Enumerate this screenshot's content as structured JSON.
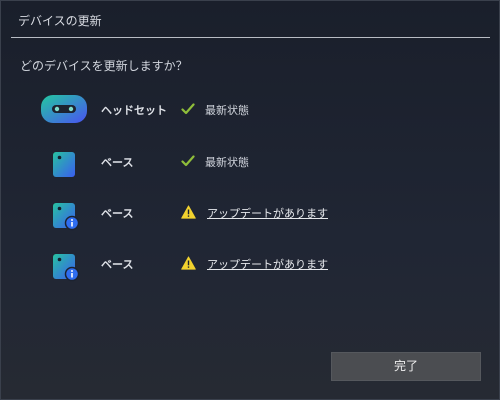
{
  "dialog": {
    "title": "デバイスの更新",
    "question": "どのデバイスを更新しますか？",
    "done_label": "完了"
  },
  "devices": [
    {
      "name": "ヘッドセット",
      "icon": "headset-icon",
      "status": "up-to-date",
      "status_label": "最新状態"
    },
    {
      "name": "ベース",
      "icon": "base-station-icon",
      "status": "up-to-date",
      "status_label": "最新状態"
    },
    {
      "name": "ベース",
      "icon": "base-station-info-icon",
      "status": "update-available",
      "status_label": "アップデートがあります"
    },
    {
      "name": "ベース",
      "icon": "base-station-info-icon",
      "status": "update-available",
      "status_label": "アップデートがあります"
    }
  ],
  "colors": {
    "check": "#8fbe3a",
    "warning": "#f2d22e",
    "device_gradient_start": "#27c2a0",
    "device_gradient_end": "#3a5df0",
    "info_badge": "#2f6df0"
  }
}
